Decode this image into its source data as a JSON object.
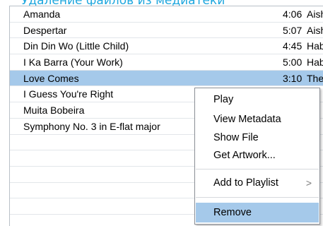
{
  "heading": "Удаление файлов из медиатеки",
  "tracks": [
    {
      "name": "Amanda",
      "time": "4:06",
      "artist": "Aisha"
    },
    {
      "name": "Despertar",
      "time": "5:07",
      "artist": "Aisha"
    },
    {
      "name": "Din Din Wo (Little Child)",
      "time": "4:45",
      "artist": "Habib"
    },
    {
      "name": "I Ka Barra (Your Work)",
      "time": "5:00",
      "artist": "Habib"
    },
    {
      "name": "Love Comes",
      "time": "3:10",
      "artist": "The"
    },
    {
      "name": "I Guess You're Right",
      "time": "",
      "artist": ""
    },
    {
      "name": "Muita Bobeira",
      "time": "",
      "artist": ""
    },
    {
      "name": "Symphony No. 3 in E-flat major",
      "time": "",
      "artist": ""
    },
    {
      "name": "",
      "time": "",
      "artist": ""
    },
    {
      "name": "",
      "time": "",
      "artist": ""
    },
    {
      "name": "",
      "time": "",
      "artist": ""
    },
    {
      "name": "",
      "time": "",
      "artist": ""
    },
    {
      "name": "",
      "time": "",
      "artist": ""
    },
    {
      "name": "",
      "time": "",
      "artist": ""
    }
  ],
  "selected_track_index": 4,
  "context_menu": {
    "play": "Play",
    "view_metadata": "View Metadata",
    "show_file": "Show File",
    "get_artwork": "Get Artwork...",
    "add_to_playlist": "Add to Playlist",
    "submenu_arrow": ">",
    "remove": "Remove",
    "highlighted_item": "Remove"
  },
  "colors": {
    "heading": "#1fa7de",
    "selection": "#a5c9ea"
  },
  "icons": {
    "submenu": "chevron-right-icon"
  }
}
